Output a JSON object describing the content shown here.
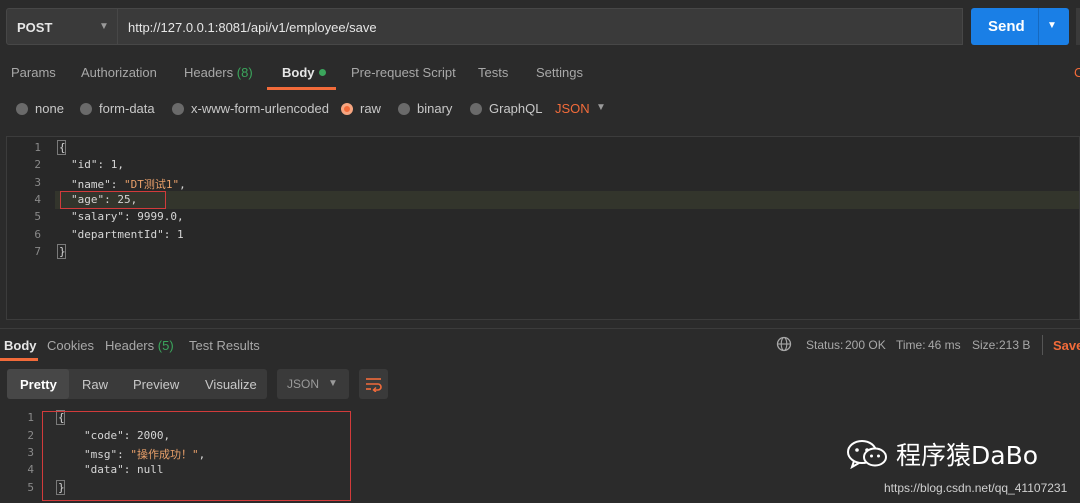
{
  "request": {
    "method": "POST",
    "url": "http://127.0.0.1:8081/api/v1/employee/save",
    "send_label": "Send"
  },
  "tabs": {
    "params": "Params",
    "authorization": "Authorization",
    "headers": "Headers",
    "headers_count": "(8)",
    "body": "Body",
    "prerequest": "Pre-request Script",
    "tests": "Tests",
    "settings": "Settings",
    "edge": "C"
  },
  "body_types": {
    "none": "none",
    "form_data": "form-data",
    "urlencoded": "x-www-form-urlencoded",
    "raw": "raw",
    "binary": "binary",
    "graphql": "GraphQL",
    "format": "JSON",
    "selected": "raw"
  },
  "request_body": {
    "lines": [
      "1",
      "2",
      "3",
      "4",
      "5",
      "6",
      "7"
    ],
    "open": "{",
    "close": "}",
    "id_key": "\"id\"",
    "id_val": "1",
    "name_key": "\"name\"",
    "name_val": "\"DT测试1\"",
    "age_key": "\"age\"",
    "age_val": "25",
    "salary_key": "\"salary\"",
    "salary_val": "9999.0",
    "dept_key": "\"departmentId\"",
    "dept_val": "1"
  },
  "response_tabs": {
    "body": "Body",
    "cookies": "Cookies",
    "headers": "Headers",
    "headers_count": "(5)",
    "test_results": "Test Results",
    "status_label": "Status:",
    "status_value": "200 OK",
    "time_label": "Time:",
    "time_value": "46 ms",
    "size_label": "Size:",
    "size_value": "213 B",
    "save": "Save"
  },
  "response_toolbar": {
    "pretty": "Pretty",
    "raw": "Raw",
    "preview": "Preview",
    "visualize": "Visualize",
    "format": "JSON"
  },
  "response_body": {
    "lines": [
      "1",
      "2",
      "3",
      "4",
      "5"
    ],
    "open": "{",
    "close": "}",
    "code_key": "\"code\"",
    "code_val": "2000",
    "msg_key": "\"msg\"",
    "msg_val": "\"操作成功！\"",
    "data_key": "\"data\"",
    "data_val": "null"
  },
  "watermark": {
    "text": "程序猿DaBo",
    "csdn": "https://blog.csdn.net/qq_41107231"
  },
  "colors": {
    "accent": "#f26b3a",
    "send": "#1a7fe6",
    "ok": "#3ba55c",
    "highlight_box": "#d23b3b"
  }
}
